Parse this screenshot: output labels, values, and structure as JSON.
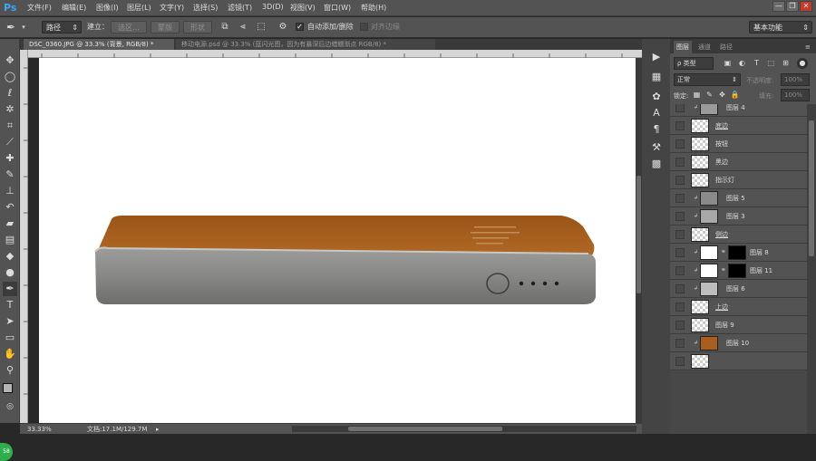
{
  "app": {
    "logo": "Ps",
    "accent": "#3ea6f4"
  },
  "menus": [
    "文件(F)",
    "编辑(E)",
    "图像(I)",
    "图层(L)",
    "文字(Y)",
    "选择(S)",
    "滤镜(T)",
    "3D(D)",
    "视图(V)",
    "窗口(W)",
    "帮助(H)"
  ],
  "window_buttons": {
    "minimize": "—",
    "restore": "❐",
    "close": "✕"
  },
  "options": {
    "tool_icon": "pen-icon",
    "mode_value": "路径",
    "build_label": "建立：",
    "selection_label": "选区...",
    "mask_label": "蒙版",
    "shape_label": "形状",
    "auto_add_delete": "自动添加/删除",
    "auto_add_delete_checked": true,
    "align_edges": "对齐边缘",
    "workspace": "基本功能"
  },
  "tabs": [
    {
      "label": "DSC_0360.JPG @ 33.3% (背景, RGB/8) *",
      "active": true
    },
    {
      "label": "移动电源.psd @ 33.3% (蓝闪光图，因为有暴深后边蜡蠕渐点 RGB/8) *",
      "active": false
    }
  ],
  "status": {
    "zoom": "33.33%",
    "doc": "文档:17.1M/129.7M"
  },
  "avatar_text": "58",
  "colors": {
    "device_top": "#a85e1e",
    "device_body": "#8a8a88",
    "canvas": "#ffffff",
    "foreground": "#b5b5b5",
    "background": "#000000"
  },
  "panel": {
    "tabs": [
      "图层",
      "通道",
      "路径"
    ],
    "filter_label": "ρ 类型",
    "blend_mode": "正常",
    "opacity_label": "不透明度:",
    "opacity_value": "100%",
    "lock_label": "锁定:",
    "fill_label": "填充:",
    "fill_value": "100%",
    "layers": [
      {
        "name": "图层 4",
        "thumb": "solid",
        "color": "#9a9a9a",
        "clip": true
      },
      {
        "name": "底边",
        "thumb": "checker",
        "underline": true
      },
      {
        "name": "按钮",
        "thumb": "checker"
      },
      {
        "name": "黑边",
        "thumb": "checker"
      },
      {
        "name": "指示灯",
        "thumb": "checker"
      },
      {
        "name": "图层 5",
        "thumb": "solid",
        "color": "#8a8a8a",
        "clip": true
      },
      {
        "name": "图层 3",
        "thumb": "solid",
        "color": "#a8a8a8",
        "clip": true
      },
      {
        "name": "侧边",
        "thumb": "checker",
        "underline": true
      },
      {
        "name": "图层 8",
        "thumb": "solid",
        "color": "#ffffff",
        "clip": true,
        "mask": true
      },
      {
        "name": "图层 11",
        "thumb": "solid",
        "color": "#ffffff",
        "clip": true,
        "mask": true
      },
      {
        "name": "图层 6",
        "thumb": "solid",
        "color": "#bdbdbd",
        "clip": true
      },
      {
        "name": "上边",
        "thumb": "checker",
        "underline": true
      },
      {
        "name": "图层 9",
        "thumb": "checker"
      },
      {
        "name": "图层 10",
        "thumb": "solid",
        "color": "#a85e1e",
        "clip": true
      },
      {
        "name": "",
        "thumb": "checker"
      }
    ]
  }
}
